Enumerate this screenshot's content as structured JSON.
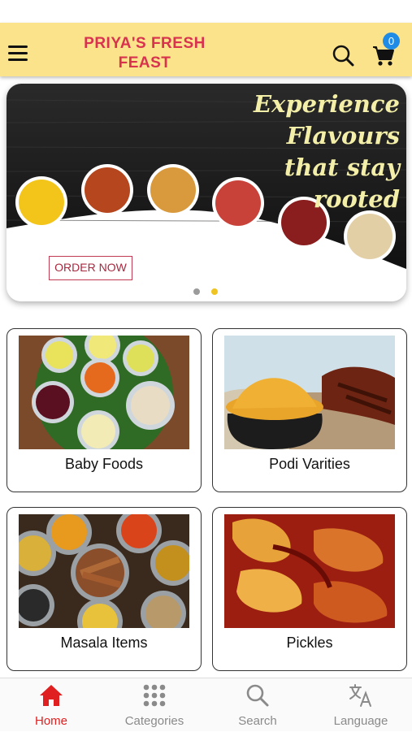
{
  "header": {
    "brand": "PRIYA'S FRESH FEAST",
    "cart_count": "0"
  },
  "banner": {
    "tagline": "Experience Flavours that stay rooted",
    "order_button": "ORDER NOW",
    "slide_count": 2,
    "active_slide": 2
  },
  "categories": [
    {
      "label": "Baby Foods"
    },
    {
      "label": "Podi Varities"
    },
    {
      "label": "Masala Items"
    },
    {
      "label": "Pickles"
    }
  ],
  "tabs": [
    {
      "label": "Home",
      "icon": "home-icon",
      "active": true
    },
    {
      "label": "Categories",
      "icon": "grid-icon",
      "active": false
    },
    {
      "label": "Search",
      "icon": "search-icon",
      "active": false
    },
    {
      "label": "Language",
      "icon": "translate-icon",
      "active": false
    }
  ],
  "colors": {
    "header_bg": "#fbe38c",
    "brand": "#d8324e",
    "badge": "#1e8ce6",
    "active_tab": "#e02020"
  }
}
